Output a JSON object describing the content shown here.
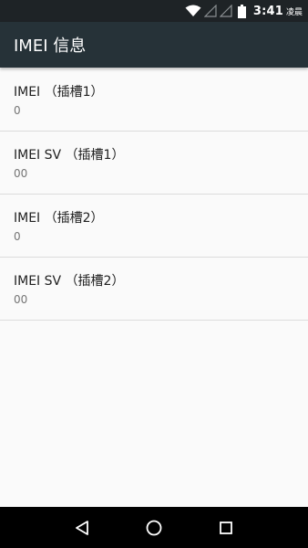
{
  "status_bar": {
    "time": "3:41",
    "suffix": "凌晨",
    "icons": [
      "wifi-icon",
      "signal-empty-icon",
      "signal-empty-icon",
      "battery-icon"
    ]
  },
  "app_bar": {
    "title": "IMEI 信息"
  },
  "list": {
    "items": [
      {
        "title": "IMEI （插槽1）",
        "value": "0"
      },
      {
        "title": "IMEI SV （插槽1）",
        "value": "00"
      },
      {
        "title": "IMEI （插槽2）",
        "value": "0"
      },
      {
        "title": "IMEI SV （插槽2）",
        "value": "00"
      }
    ]
  },
  "nav_bar": {
    "buttons": [
      "back-icon",
      "home-icon",
      "recents-icon"
    ]
  },
  "colors": {
    "status_bar": "#1e2326",
    "app_bar": "#263238",
    "background": "#fafafa",
    "divider": "#dcdcdc",
    "title_text": "#212121",
    "value_text": "#757575"
  }
}
